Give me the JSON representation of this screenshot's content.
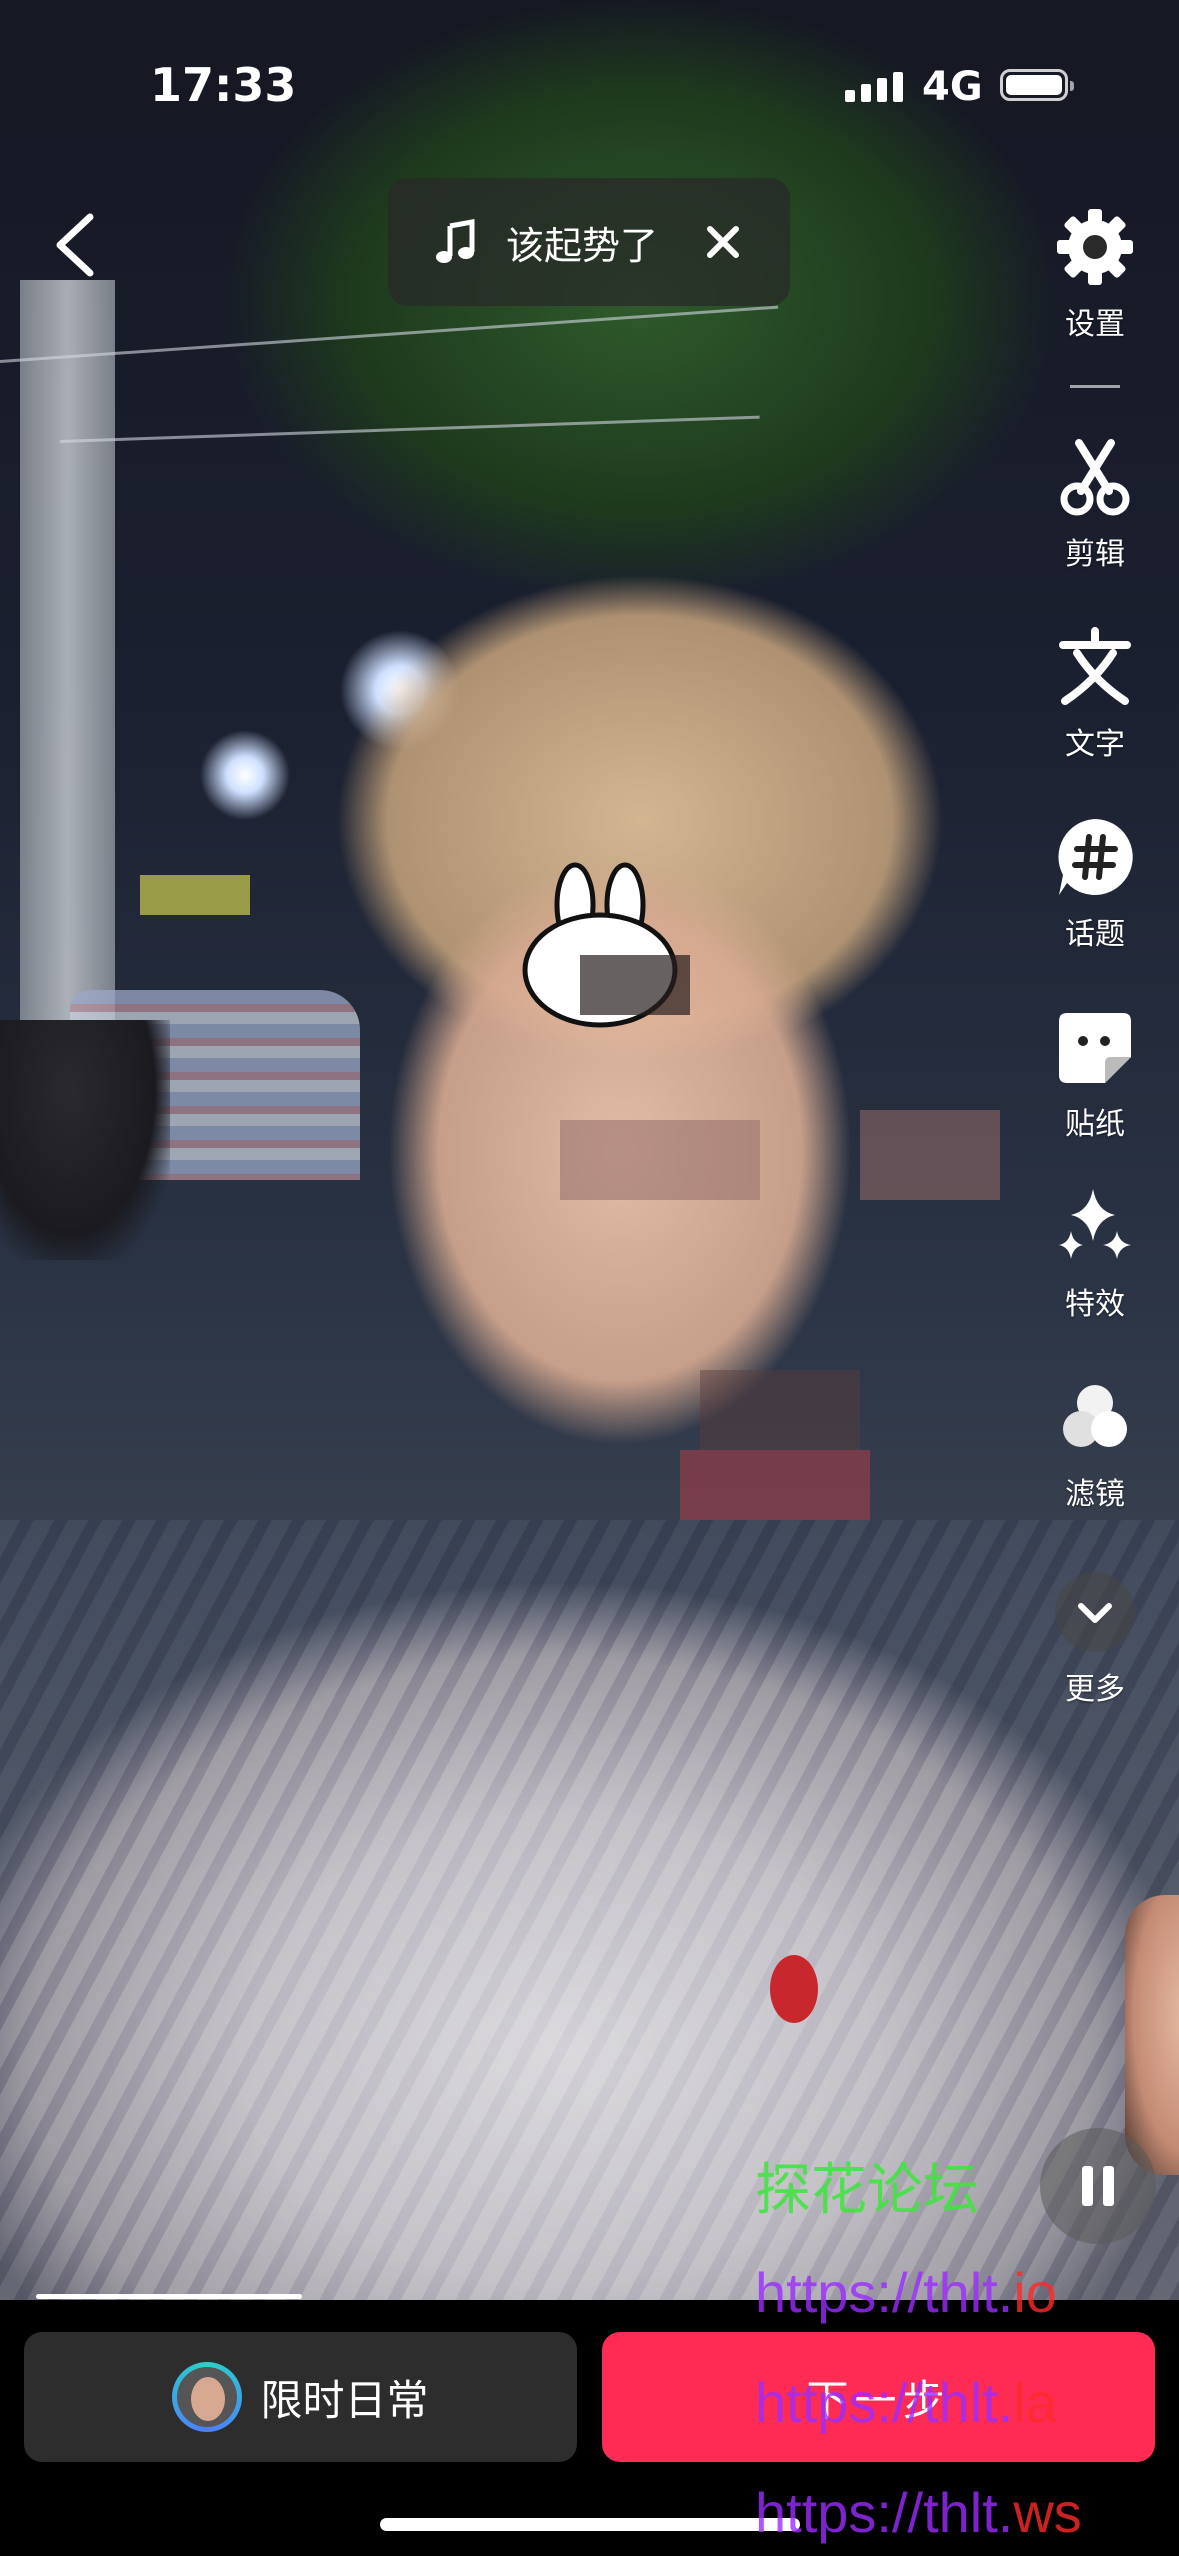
{
  "status_bar": {
    "time": "17:33",
    "network": "4G"
  },
  "music": {
    "title": "该起势了"
  },
  "tools": [
    {
      "id": "settings",
      "label": "设置",
      "icon": "gear-icon"
    },
    {
      "id": "edit",
      "label": "剪辑",
      "icon": "scissors-icon"
    },
    {
      "id": "text",
      "label": "文字",
      "icon": "text-icon"
    },
    {
      "id": "topic",
      "label": "话题",
      "icon": "hashtag-icon"
    },
    {
      "id": "sticker",
      "label": "贴纸",
      "icon": "sticker-icon"
    },
    {
      "id": "effects",
      "label": "特效",
      "icon": "sparkle-icon"
    },
    {
      "id": "filter",
      "label": "滤镜",
      "icon": "filter-icon"
    },
    {
      "id": "more",
      "label": "更多",
      "icon": "chevron-down-icon"
    }
  ],
  "playback": {
    "progress": 0.24
  },
  "bottom": {
    "daily_label": "限时日常",
    "next_label": "下一步"
  },
  "watermark": {
    "site_name": "探花论坛",
    "links": [
      {
        "pre": "https://thlt.",
        "tail": "io"
      },
      {
        "pre": "https://thlt.",
        "tail": "la"
      },
      {
        "pre": "https://thlt.",
        "tail": "ws"
      }
    ]
  },
  "colors": {
    "accent": "#fe2c55",
    "watermark_green": "#3ce63c",
    "watermark_purple": "#9b2cff",
    "watermark_red": "#ff2a2a"
  }
}
